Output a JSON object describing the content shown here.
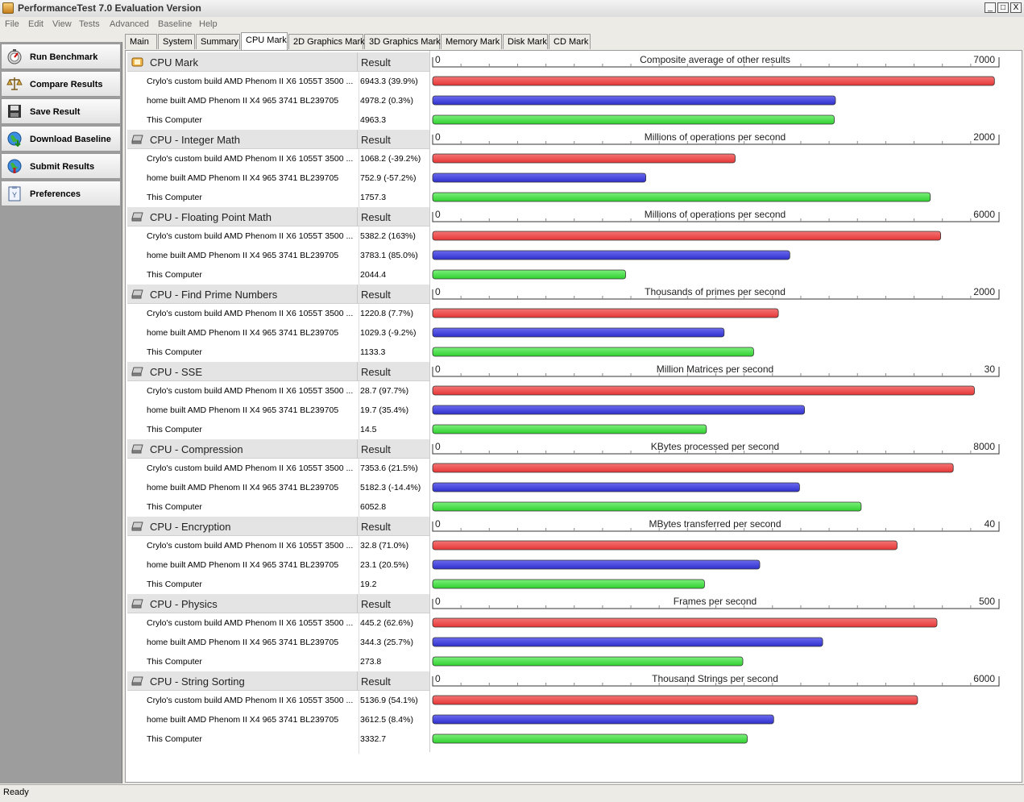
{
  "window": {
    "title": "PerformanceTest 7.0 Evaluation Version",
    "min_label": "_",
    "max_label": "□",
    "close_label": "X"
  },
  "menu": [
    "File",
    "Edit",
    "View",
    "Tests",
    "Advanced",
    "Baseline",
    "Help"
  ],
  "sidebar": [
    {
      "label": "Run Benchmark",
      "icon": "run-benchmark-icon"
    },
    {
      "label": "Compare Results",
      "icon": "scales-icon"
    },
    {
      "label": "Save Result",
      "icon": "floppy-disk-icon"
    },
    {
      "label": "Download Baseline",
      "icon": "globe-download-icon"
    },
    {
      "label": "Submit Results",
      "icon": "globe-upload-icon"
    },
    {
      "label": "Preferences",
      "icon": "clipboard-icon"
    }
  ],
  "tabs": [
    "Main",
    "System",
    "Summary",
    "CPU Mark",
    "2D Graphics Mark",
    "3D Graphics Mark",
    "Memory Mark",
    "Disk Mark",
    "CD Mark"
  ],
  "active_tab": "CPU Mark",
  "colors": {
    "red_bar": "#ee4444",
    "blue_bar": "#3d3ddf",
    "green_bar": "#3ee23e"
  },
  "result_header": "Result",
  "sections": [
    {
      "title": "CPU Mark",
      "icon": "cpu-mark-icon",
      "unit": "Composite average of other results",
      "min": "0",
      "max": "7000",
      "scale_max": 7000,
      "rows": [
        {
          "name": "Crylo's custom build AMD Phenom II X6 1055T 3500 ...",
          "result": "6943.3 (39.9%)",
          "value": 6943.3,
          "color": "red"
        },
        {
          "name": "home built AMD Phenom II X4 965 3741 BL239705",
          "result": "4978.2 (0.3%)",
          "value": 4978.2,
          "color": "blue"
        },
        {
          "name": "This Computer",
          "result": "4963.3",
          "value": 4963.3,
          "color": "green"
        }
      ]
    },
    {
      "title": "CPU - Integer Math",
      "icon": "hard-drive-icon",
      "unit": "Millions of operations per second",
      "min": "0",
      "max": "2000",
      "scale_max": 2000,
      "rows": [
        {
          "name": "Crylo's custom build AMD Phenom II X6 1055T 3500 ...",
          "result": "1068.2 (-39.2%)",
          "value": 1068.2,
          "color": "red"
        },
        {
          "name": "home built AMD Phenom II X4 965 3741 BL239705",
          "result": "752.9 (-57.2%)",
          "value": 752.9,
          "color": "blue"
        },
        {
          "name": "This Computer",
          "result": "1757.3",
          "value": 1757.3,
          "color": "green"
        }
      ]
    },
    {
      "title": "CPU - Floating Point Math",
      "icon": "hard-drive-icon",
      "unit": "Millions of operations per second",
      "min": "0",
      "max": "6000",
      "scale_max": 6000,
      "rows": [
        {
          "name": "Crylo's custom build AMD Phenom II X6 1055T 3500 ...",
          "result": "5382.2 (163%)",
          "value": 5382.2,
          "color": "red"
        },
        {
          "name": "home built AMD Phenom II X4 965 3741 BL239705",
          "result": "3783.1 (85.0%)",
          "value": 3783.1,
          "color": "blue"
        },
        {
          "name": "This Computer",
          "result": "2044.4",
          "value": 2044.4,
          "color": "green"
        }
      ]
    },
    {
      "title": "CPU - Find Prime Numbers",
      "icon": "hard-drive-icon",
      "unit": "Thousands of primes per second",
      "min": "0",
      "max": "2000",
      "scale_max": 2000,
      "rows": [
        {
          "name": "Crylo's custom build AMD Phenom II X6 1055T 3500 ...",
          "result": "1220.8 (7.7%)",
          "value": 1220.8,
          "color": "red"
        },
        {
          "name": "home built AMD Phenom II X4 965 3741 BL239705",
          "result": "1029.3 (-9.2%)",
          "value": 1029.3,
          "color": "blue"
        },
        {
          "name": "This Computer",
          "result": "1133.3",
          "value": 1133.3,
          "color": "green"
        }
      ]
    },
    {
      "title": "CPU - SSE",
      "icon": "hard-drive-icon",
      "unit": "Million Matrices per second",
      "min": "0",
      "max": "30",
      "scale_max": 30,
      "rows": [
        {
          "name": "Crylo's custom build AMD Phenom II X6 1055T 3500 ...",
          "result": "28.7 (97.7%)",
          "value": 28.7,
          "color": "red"
        },
        {
          "name": "home built AMD Phenom II X4 965 3741 BL239705",
          "result": "19.7 (35.4%)",
          "value": 19.7,
          "color": "blue"
        },
        {
          "name": "This Computer",
          "result": "14.5",
          "value": 14.5,
          "color": "green"
        }
      ]
    },
    {
      "title": "CPU - Compression",
      "icon": "hard-drive-icon",
      "unit": "KBytes processed per second",
      "min": "0",
      "max": "8000",
      "scale_max": 8000,
      "rows": [
        {
          "name": "Crylo's custom build AMD Phenom II X6 1055T 3500 ...",
          "result": "7353.6 (21.5%)",
          "value": 7353.6,
          "color": "red"
        },
        {
          "name": "home built AMD Phenom II X4 965 3741 BL239705",
          "result": "5182.3 (-14.4%)",
          "value": 5182.3,
          "color": "blue"
        },
        {
          "name": "This Computer",
          "result": "6052.8",
          "value": 6052.8,
          "color": "green"
        }
      ]
    },
    {
      "title": "CPU - Encryption",
      "icon": "hard-drive-icon",
      "unit": "MBytes transferred per second",
      "min": "0",
      "max": "40",
      "scale_max": 40,
      "rows": [
        {
          "name": "Crylo's custom build AMD Phenom II X6 1055T 3500 ...",
          "result": "32.8 (71.0%)",
          "value": 32.8,
          "color": "red"
        },
        {
          "name": "home built AMD Phenom II X4 965 3741 BL239705",
          "result": "23.1 (20.5%)",
          "value": 23.1,
          "color": "blue"
        },
        {
          "name": "This Computer",
          "result": "19.2",
          "value": 19.2,
          "color": "green"
        }
      ]
    },
    {
      "title": "CPU - Physics",
      "icon": "hard-drive-icon",
      "unit": "Frames per second",
      "min": "0",
      "max": "500",
      "scale_max": 500,
      "rows": [
        {
          "name": "Crylo's custom build AMD Phenom II X6 1055T 3500 ...",
          "result": "445.2 (62.6%)",
          "value": 445.2,
          "color": "red"
        },
        {
          "name": "home built AMD Phenom II X4 965 3741 BL239705",
          "result": "344.3 (25.7%)",
          "value": 344.3,
          "color": "blue"
        },
        {
          "name": "This Computer",
          "result": "273.8",
          "value": 273.8,
          "color": "green"
        }
      ]
    },
    {
      "title": "CPU - String Sorting",
      "icon": "hard-drive-icon",
      "unit": "Thousand Strings per second",
      "min": "0",
      "max": "6000",
      "scale_max": 6000,
      "rows": [
        {
          "name": "Crylo's custom build AMD Phenom II X6 1055T 3500 ...",
          "result": "5136.9 (54.1%)",
          "value": 5136.9,
          "color": "red"
        },
        {
          "name": "home built AMD Phenom II X4 965 3741 BL239705",
          "result": "3612.5 (8.4%)",
          "value": 3612.5,
          "color": "blue"
        },
        {
          "name": "This Computer",
          "result": "3332.7",
          "value": 3332.7,
          "color": "green"
        }
      ]
    }
  ],
  "chart_data": [
    {
      "type": "bar",
      "title": "CPU Mark",
      "xlabel": "Composite average of other results",
      "xlim": [
        0,
        7000
      ],
      "categories": [
        "Crylo's custom build AMD Phenom II X6 1055T 3500 ...",
        "home built AMD Phenom II X4 965 3741 BL239705",
        "This Computer"
      ],
      "values": [
        6943.3,
        4978.2,
        4963.3
      ]
    },
    {
      "type": "bar",
      "title": "CPU - Integer Math",
      "xlabel": "Millions of operations per second",
      "xlim": [
        0,
        2000
      ],
      "values": [
        1068.2,
        752.9,
        1757.3
      ]
    },
    {
      "type": "bar",
      "title": "CPU - Floating Point Math",
      "xlabel": "Millions of operations per second",
      "xlim": [
        0,
        6000
      ],
      "values": [
        5382.2,
        3783.1,
        2044.4
      ]
    },
    {
      "type": "bar",
      "title": "CPU - Find Prime Numbers",
      "xlabel": "Thousands of primes per second",
      "xlim": [
        0,
        2000
      ],
      "values": [
        1220.8,
        1029.3,
        1133.3
      ]
    },
    {
      "type": "bar",
      "title": "CPU - SSE",
      "xlabel": "Million Matrices per second",
      "xlim": [
        0,
        30
      ],
      "values": [
        28.7,
        19.7,
        14.5
      ]
    },
    {
      "type": "bar",
      "title": "CPU - Compression",
      "xlabel": "KBytes processed per second",
      "xlim": [
        0,
        8000
      ],
      "values": [
        7353.6,
        5182.3,
        6052.8
      ]
    },
    {
      "type": "bar",
      "title": "CPU - Encryption",
      "xlabel": "MBytes transferred per second",
      "xlim": [
        0,
        40
      ],
      "values": [
        32.8,
        23.1,
        19.2
      ]
    },
    {
      "type": "bar",
      "title": "CPU - Physics",
      "xlabel": "Frames per second",
      "xlim": [
        0,
        500
      ],
      "values": [
        445.2,
        344.3,
        273.8
      ]
    },
    {
      "type": "bar",
      "title": "CPU - String Sorting",
      "xlabel": "Thousand Strings per second",
      "xlim": [
        0,
        6000
      ],
      "values": [
        5136.9,
        3612.5,
        3332.7
      ]
    }
  ],
  "status": "Ready"
}
